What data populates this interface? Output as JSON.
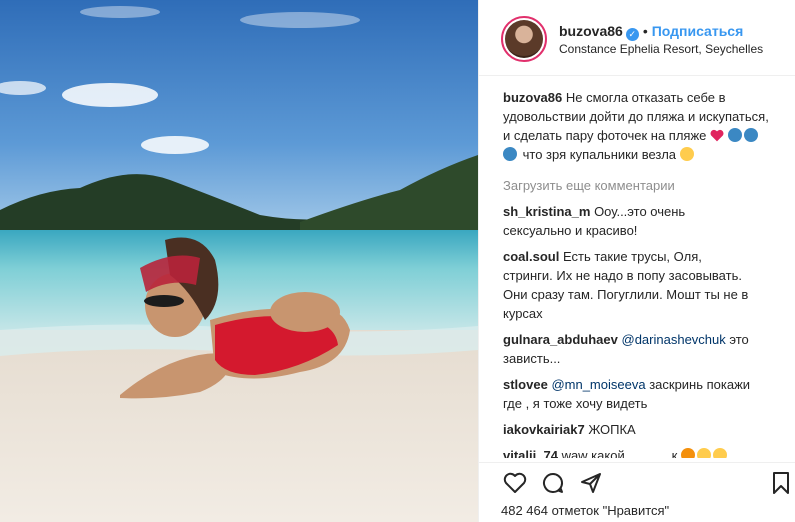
{
  "post": {
    "username": "buzova86",
    "verified_mark": "✓",
    "separator": "•",
    "follow_label": "Подписаться",
    "location": "Constance Ephelia Resort, Seychelles"
  },
  "caption": {
    "username": "buzova86",
    "text_before": "Не смогла отказать себе в удовольствии дойти до пляжа и искупаться, и сделать пару фоточек на пляже",
    "text_after": "что зря купальники везла"
  },
  "load_more_label": "Загрузить еще комментарии",
  "comments": [
    {
      "username": "sh_kristina_m",
      "text": "Ооу...это очень сексуально и красиво!"
    },
    {
      "username": "coal.soul",
      "text": "Есть такие трусы, Оля, стринги. Их не надо в попу засовывать. Они сразу там. Погуглили. Мошт ты не в курсах"
    },
    {
      "username": "gulnara_abduhaev",
      "mention": "@darinashevchuk",
      "text": "это зависть..."
    },
    {
      "username": "stlovee",
      "mention": "@mn_moiseeva",
      "text": "заскринь покажи где , я тоже хочу видеть"
    },
    {
      "username": "iakovkairiak7",
      "text": "ЖОПКА"
    },
    {
      "username": "vitalii_74",
      "text": "waw какой.............к"
    }
  ],
  "likes_text": "482 464 отметок \"Нравится\"",
  "colors": {
    "accent": "#3897f0",
    "text": "#262626",
    "muted": "#8e8e8e",
    "mention": "#003569"
  },
  "icons": [
    "heart-icon",
    "comment-icon",
    "share-icon",
    "bookmark-icon",
    "verified-icon"
  ]
}
